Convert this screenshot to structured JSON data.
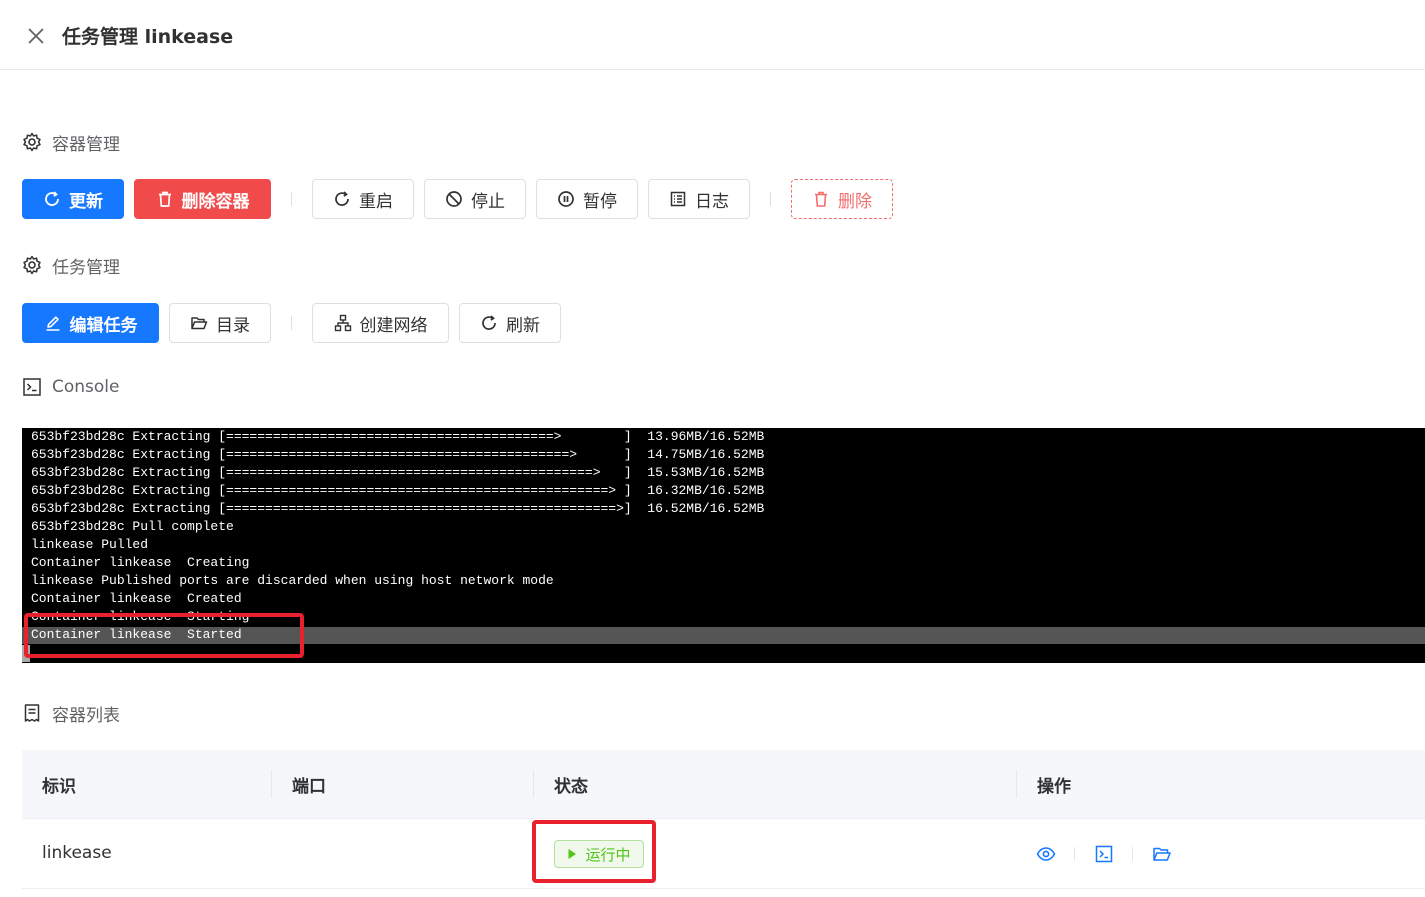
{
  "header": {
    "title": "任务管理 linkease"
  },
  "container_section": {
    "title": "容器管理",
    "buttons": {
      "update": "更新",
      "delete_container": "删除容器",
      "restart": "重启",
      "stop": "停止",
      "pause": "暂停",
      "logs": "日志",
      "delete": "删除"
    }
  },
  "task_section": {
    "title": "任务管理",
    "buttons": {
      "edit_task": "编辑任务",
      "directory": "目录",
      "create_network": "创建网络",
      "refresh": "刷新"
    }
  },
  "console": {
    "title": "Console",
    "lines": [
      "653bf23bd28c Extracting [==========================================>        ]  13.96MB/16.52MB",
      "653bf23bd28c Extracting [============================================>      ]  14.75MB/16.52MB",
      "653bf23bd28c Extracting [===============================================>   ]  15.53MB/16.52MB",
      "653bf23bd28c Extracting [=================================================> ]  16.32MB/16.52MB",
      "653bf23bd28c Extracting [==================================================>]  16.52MB/16.52MB",
      "653bf23bd28c Pull complete",
      "linkease Pulled",
      "Container linkease  Creating",
      "linkease Published ports are discarded when using host network mode",
      "Container linkease  Created",
      "Container linkease  Starting",
      "Container linkease  Started"
    ]
  },
  "container_list": {
    "title": "容器列表",
    "columns": [
      "标识",
      "端口",
      "状态",
      "操作"
    ],
    "rows": [
      {
        "id": "linkease",
        "port": "",
        "status": "运行中"
      }
    ]
  },
  "colors": {
    "primary": "#1677ff",
    "danger": "#f04a4a",
    "success": "#52c41a",
    "highlight_box": "#e8212c"
  }
}
